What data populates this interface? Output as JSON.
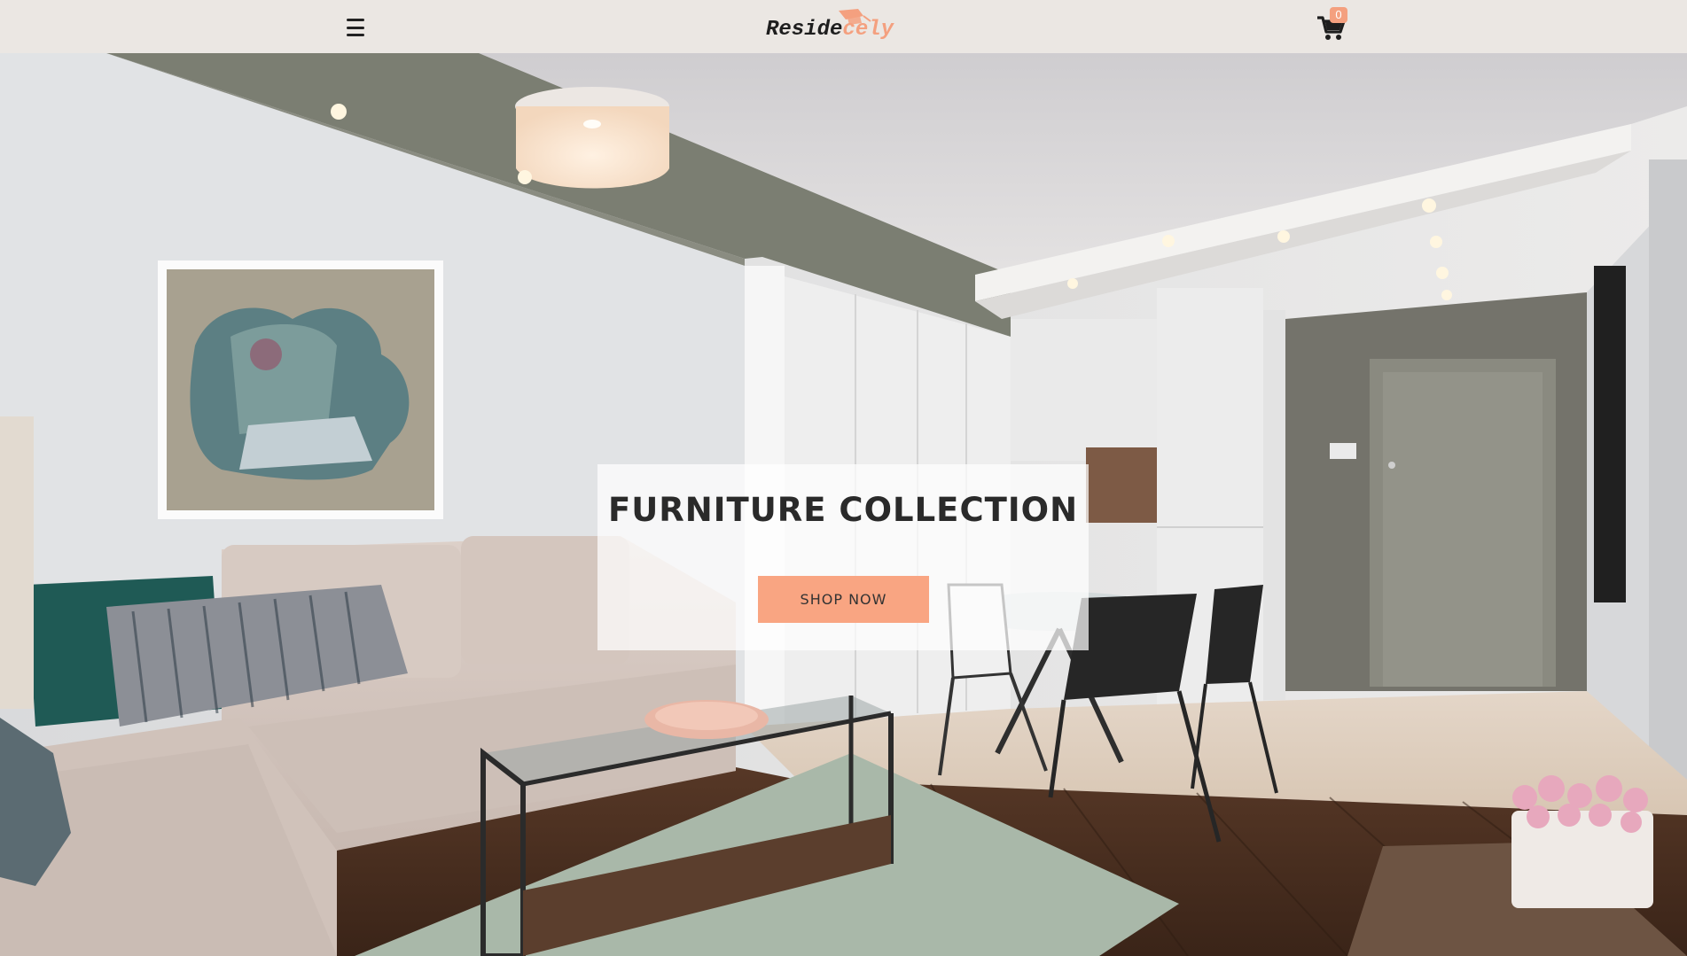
{
  "header": {
    "logo_part1": "Reside",
    "logo_part2": "cely",
    "cart_count": "0"
  },
  "hero": {
    "title": "FURNITURE COLLECTION",
    "cta_label": "SHOP NOW"
  },
  "colors": {
    "accent": "#f9a582",
    "header_bg": "#ebe7e3",
    "text_dark": "#2a2a2a"
  },
  "icons": {
    "menu": "hamburger-icon",
    "cart": "shopping-cart-icon",
    "logo_mark": "graduation-cap-icon"
  }
}
